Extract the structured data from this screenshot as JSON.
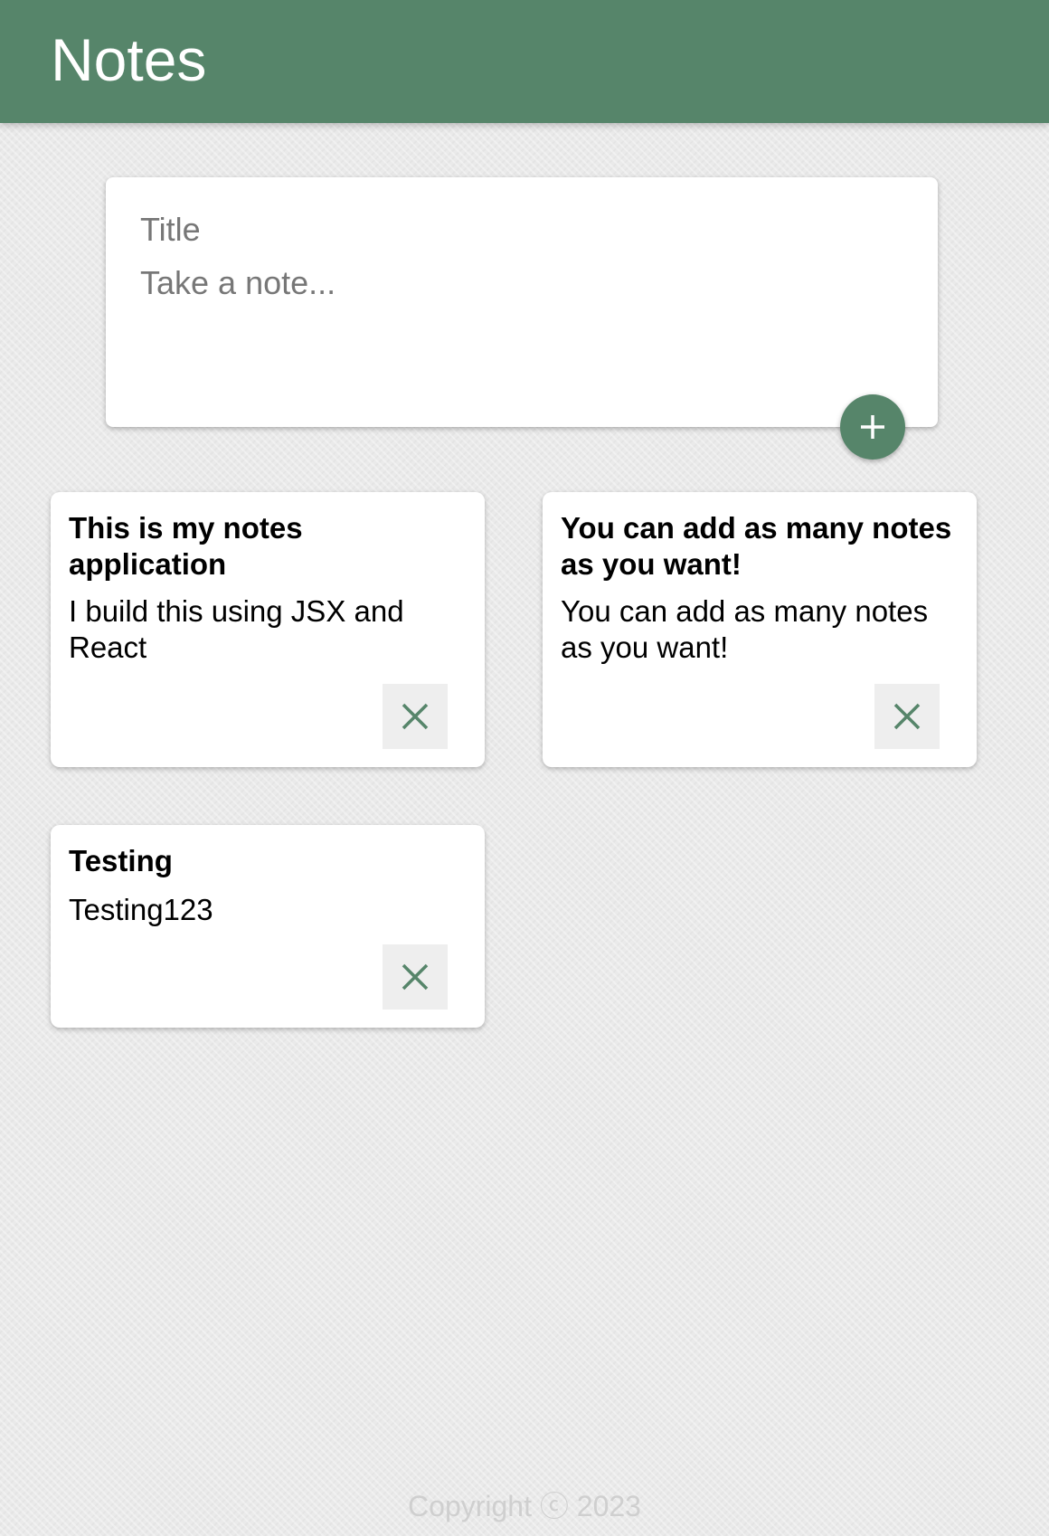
{
  "header": {
    "title": "Notes"
  },
  "create_area": {
    "title_placeholder": "Title",
    "content_placeholder": "Take a note...",
    "add_icon": "plus-icon"
  },
  "notes": [
    {
      "title": "This is my notes application",
      "content": "I build this using JSX and React",
      "delete_icon": "close-icon"
    },
    {
      "title": "You can add as many notes as you want!",
      "content": "You can add as many notes as you want!",
      "delete_icon": "close-icon"
    },
    {
      "title": "Testing",
      "content": "Testing123",
      "delete_icon": "close-icon"
    }
  ],
  "footer": {
    "copyright": "Copyright ⓒ 2023"
  },
  "colors": {
    "accent": "#56856a",
    "background": "#eaeaea",
    "card": "#ffffff",
    "delete_button_bg": "#eeeeee"
  }
}
